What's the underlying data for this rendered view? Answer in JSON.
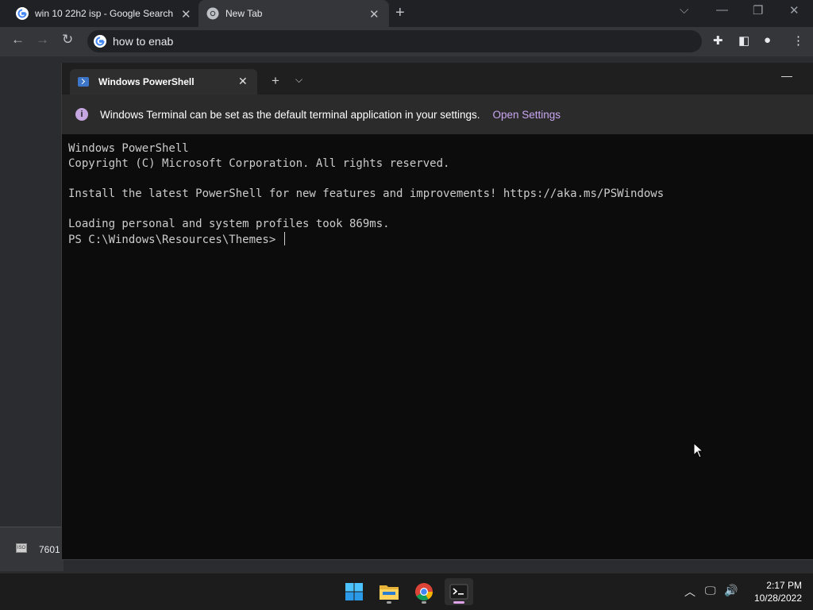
{
  "chrome": {
    "tabs": [
      {
        "title": "win 10 22h2 isp - Google Search",
        "icon": "google-g-icon"
      },
      {
        "title": "New Tab",
        "icon": "chrome-icon"
      }
    ],
    "address_text": "how to enab"
  },
  "download_shelf": {
    "item_label": "7601"
  },
  "terminal": {
    "tab_title": "Windows PowerShell",
    "info_text": "Windows Terminal can be set as the default terminal application in your settings.",
    "info_link": "Open Settings",
    "lines": [
      "Windows PowerShell",
      "Copyright (C) Microsoft Corporation. All rights reserved.",
      "",
      "Install the latest PowerShell for new features and improvements! https://aka.ms/PSWindows",
      "",
      "Loading personal and system profiles took 869ms.",
      "PS C:\\Windows\\Resources\\Themes> "
    ]
  },
  "taskbar": {
    "time": "2:17 PM",
    "date": "10/28/2022"
  },
  "colors": {
    "terminal_bg": "#0c0c0c",
    "accent_link": "#c9a7f2",
    "chrome_bg": "#202124"
  }
}
